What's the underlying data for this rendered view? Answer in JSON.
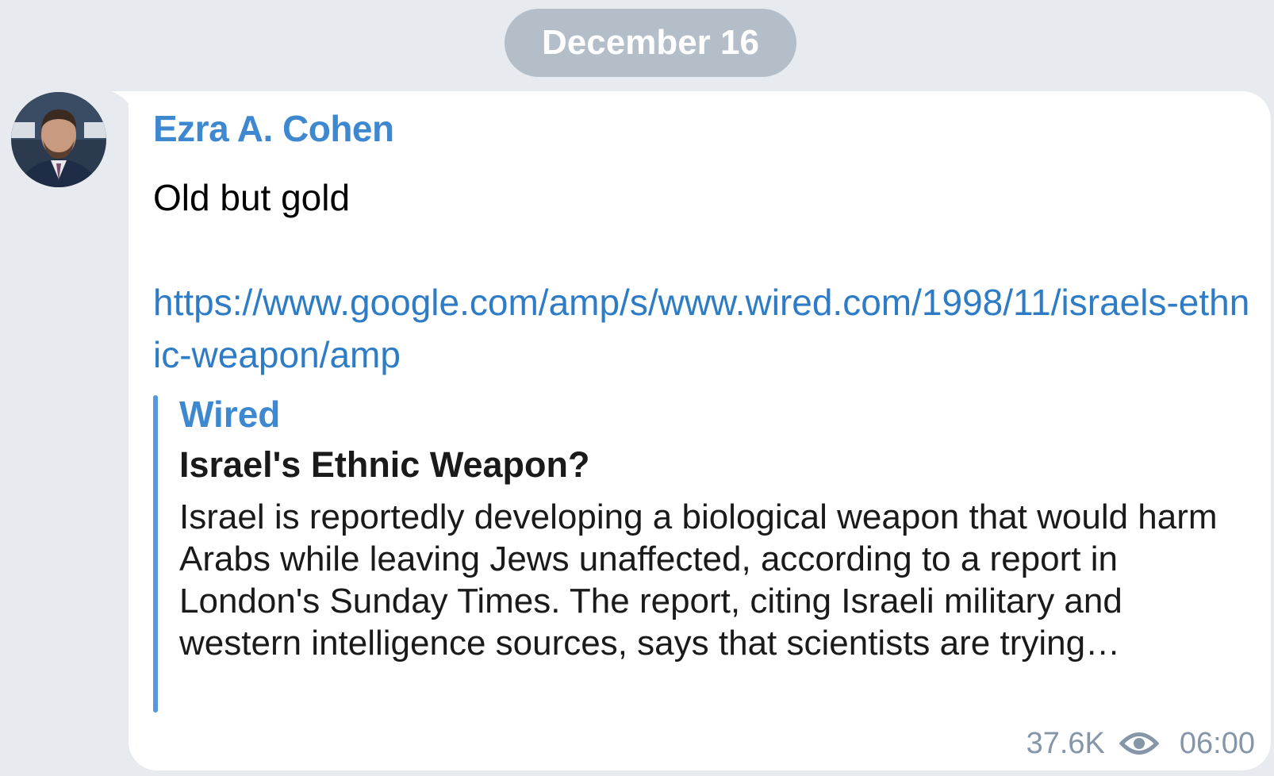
{
  "date_label": "December 16",
  "message": {
    "sender": "Ezra A. Cohen",
    "text": "Old but gold",
    "link": "https://www.google.com/amp/s/www.wired.com/1998/11/israels-ethnic-weapon/amp",
    "preview": {
      "site_name": "Wired",
      "title": "Israel's Ethnic Weapon?",
      "description": "Israel is reportedly developing a biological weapon that would harm Arabs while leaving Jews unaffected, according to a report in London's Sunday Times. The report, citing Israeli military and western intelligence sources, says that scientists are trying…"
    },
    "views": "37.6K",
    "time": "06:00",
    "views_icon": "eye-icon"
  },
  "colors": {
    "background": "#e7ebf0",
    "date_pill": "#b4bec9",
    "accent": "#3e88d0",
    "link": "#2f7cc6",
    "meta": "#8596a8"
  }
}
